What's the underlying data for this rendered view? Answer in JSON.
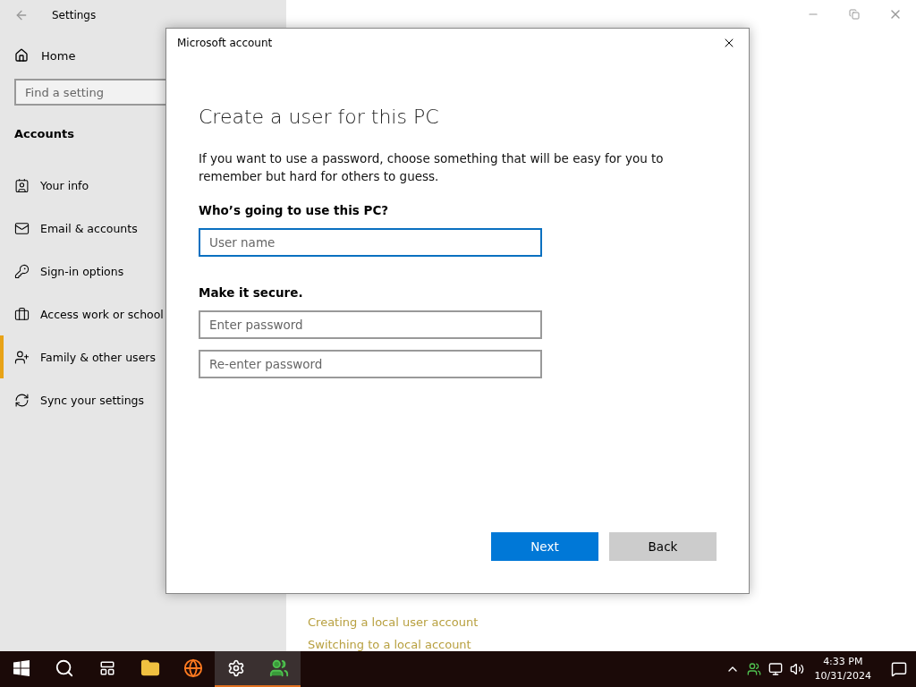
{
  "window": {
    "title": "Settings"
  },
  "sidebar": {
    "home": "Home",
    "search": {
      "placeholder": "Find a setting"
    },
    "section": "Accounts",
    "items": [
      {
        "label": "Your info",
        "selected": false
      },
      {
        "label": "Email & accounts",
        "selected": false
      },
      {
        "label": "Sign-in options",
        "selected": false
      },
      {
        "label": "Access work or school",
        "selected": false
      },
      {
        "label": "Family & other users",
        "selected": true
      },
      {
        "label": "Sync your settings",
        "selected": false
      }
    ]
  },
  "content": {
    "links": [
      "Creating a local user account",
      "Switching to a local account"
    ]
  },
  "dialog": {
    "title": "Microsoft account",
    "heading": "Create a user for this PC",
    "description": "If you want to use a password, choose something that will be easy for you to remember but hard for others to guess.",
    "sections": [
      {
        "label": "Who’s going to use this PC?",
        "fields": [
          {
            "placeholder": "User name",
            "focused": true
          }
        ]
      },
      {
        "label": "Make it secure.",
        "fields": [
          {
            "placeholder": "Enter password",
            "focused": false
          },
          {
            "placeholder": "Re-enter password",
            "focused": false
          }
        ]
      }
    ],
    "buttons": [
      {
        "label": "Next",
        "primary": true
      },
      {
        "label": "Back",
        "primary": false
      }
    ]
  },
  "taskbar": {
    "apps": [
      {
        "active": false
      },
      {
        "active": false
      },
      {
        "active": false
      },
      {
        "active": false
      },
      {
        "active": true
      },
      {
        "active": true
      }
    ],
    "time": "4:33 PM",
    "date": "10/31/2024"
  }
}
